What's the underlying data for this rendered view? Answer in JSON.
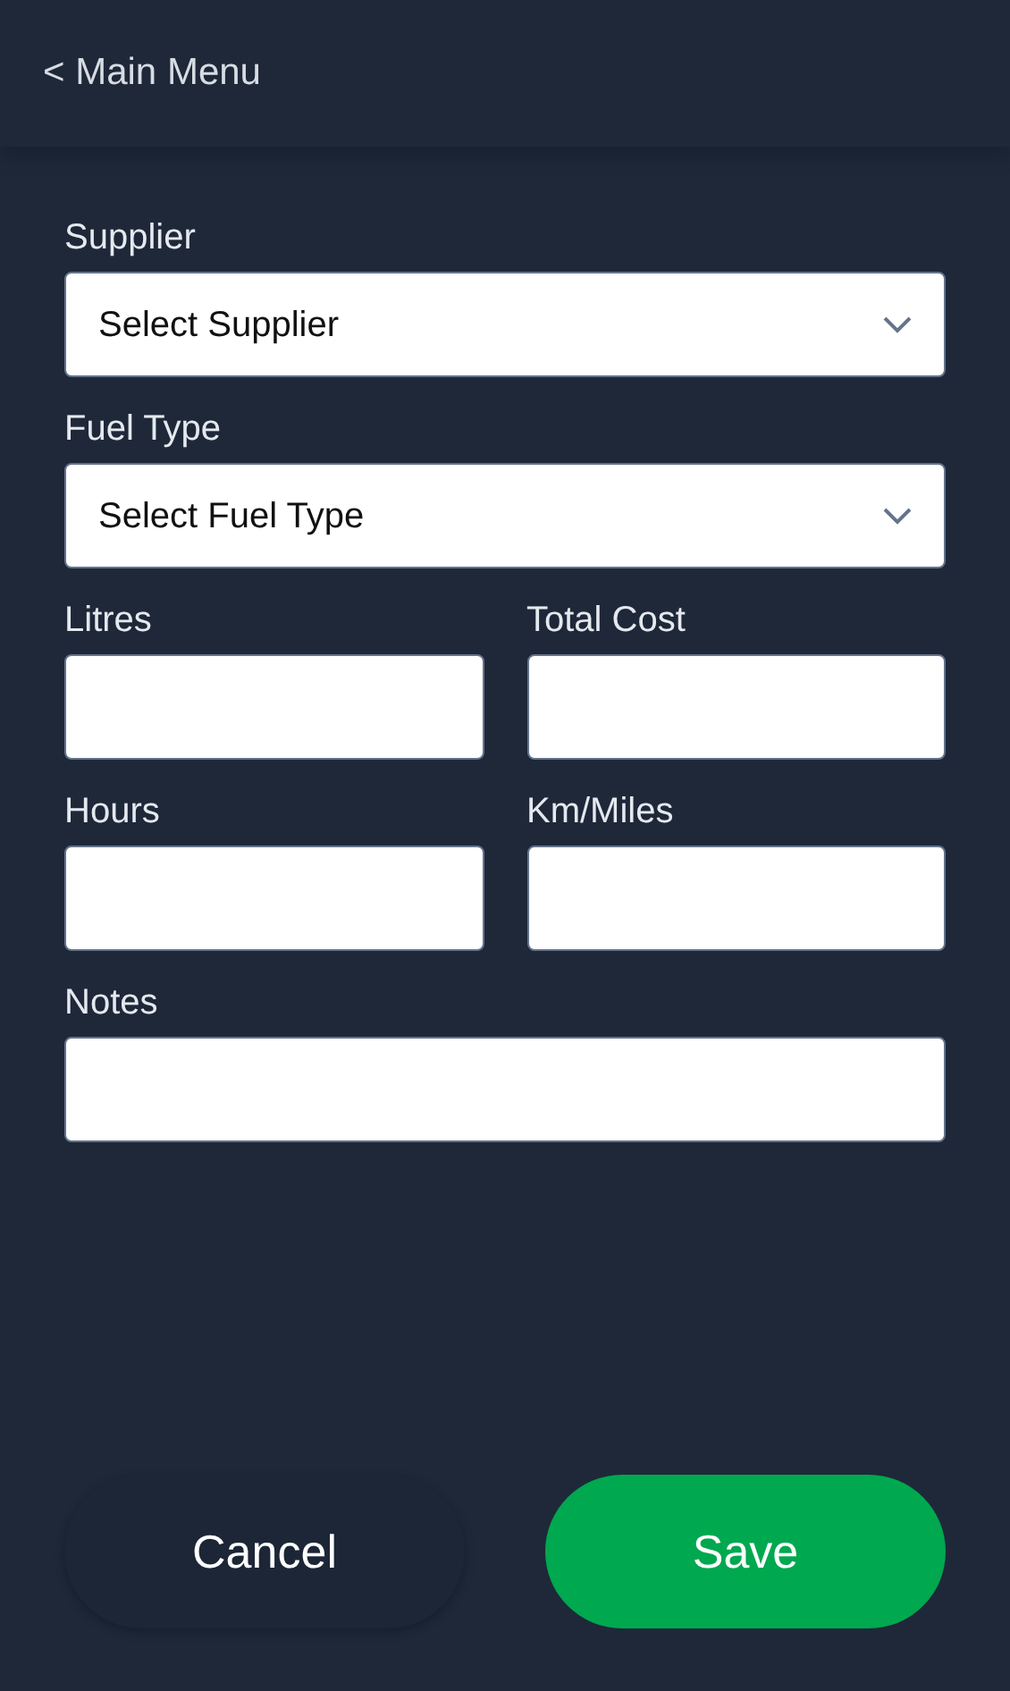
{
  "header": {
    "back_link": "< Main Menu"
  },
  "rows": [
    [
      {
        "label": "Supplier",
        "kind": "select",
        "placeholder": "Select Supplier"
      }
    ],
    [
      {
        "label": "Fuel Type",
        "kind": "select",
        "placeholder": "Select Fuel Type"
      }
    ],
    [
      {
        "label": "Litres",
        "kind": "text"
      },
      {
        "label": "Total Cost",
        "kind": "text"
      }
    ],
    [
      {
        "label": "Hours",
        "kind": "text"
      },
      {
        "label": "Km/Miles",
        "kind": "text"
      }
    ],
    [
      {
        "label": "Notes",
        "kind": "text"
      }
    ]
  ],
  "buttons": [
    {
      "label": "Cancel",
      "kind": "secondary"
    },
    {
      "label": "Save",
      "kind": "primary"
    }
  ]
}
